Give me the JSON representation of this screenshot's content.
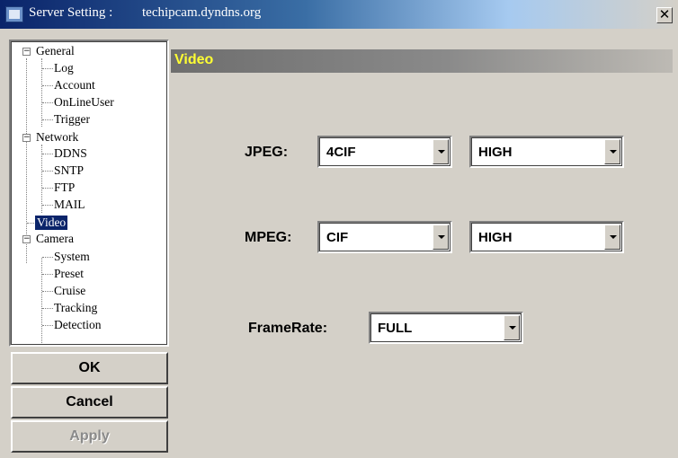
{
  "window": {
    "title_label": "Server Setting :",
    "title_host": "techipcam.dyndns.org",
    "close_glyph": "✕"
  },
  "tree": {
    "general": {
      "label": "General",
      "children": [
        "Log",
        "Account",
        "OnLineUser",
        "Trigger"
      ]
    },
    "network": {
      "label": "Network",
      "children": [
        "DDNS",
        "SNTP",
        "FTP",
        "MAIL"
      ]
    },
    "video": {
      "label": "Video"
    },
    "camera": {
      "label": "Camera",
      "children": [
        "System",
        "Preset",
        "Cruise",
        "Tracking",
        "Detection"
      ]
    },
    "expander_glyph": "−"
  },
  "buttons": {
    "ok": "OK",
    "cancel": "Cancel",
    "apply": "Apply"
  },
  "panel": {
    "title": "Video",
    "jpeg_label": "JPEG:",
    "jpeg_resolution": "4CIF",
    "jpeg_quality": "HIGH",
    "mpeg_label": "MPEG:",
    "mpeg_resolution": "CIF",
    "mpeg_quality": "HIGH",
    "framerate_label": "FrameRate:",
    "framerate_value": "FULL"
  },
  "colors": {
    "header_title": "#ffff33",
    "selection": "#0a246a",
    "title_bar": "#0a246a"
  },
  "icons": {
    "app": "app-icon",
    "close": "close-icon",
    "dropdown": "chevron-down-icon"
  }
}
